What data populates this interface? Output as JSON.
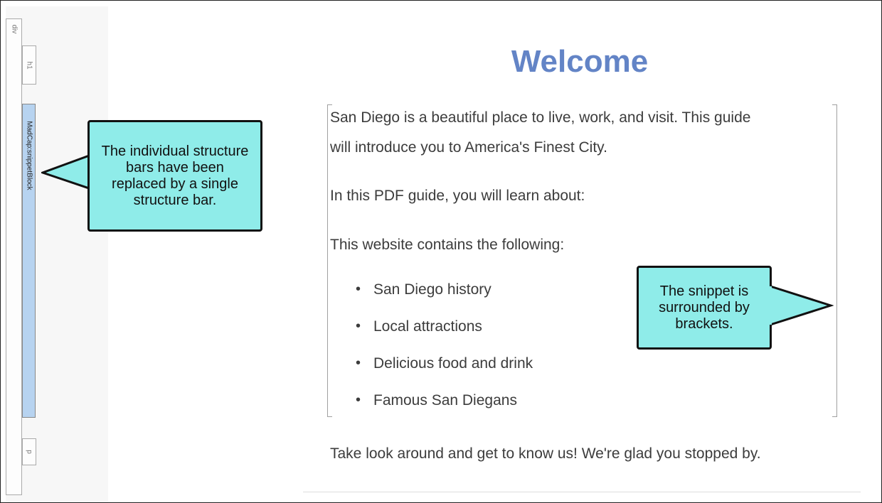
{
  "structure_bars": {
    "div": "div",
    "h1": "h1",
    "snippet": "MadCap:snippetBlock",
    "p": "p"
  },
  "content": {
    "title": "Welcome",
    "para1_line1": "San Diego is a beautiful place to live, work, and visit. This guide",
    "para1_line2": "will introduce you to America's Finest City.",
    "para2": "In this PDF guide, you will learn about:",
    "para3": "This website contains the following:",
    "bullets": [
      "San Diego history",
      "Local attractions",
      "Delicious food and drink",
      "Famous San Diegans"
    ],
    "para4": "Take look around and get to know us! We're glad you stopped by."
  },
  "callouts": {
    "left": "The individual structure bars have been replaced by a single structure bar.",
    "right": "The snippet is surrounded by brackets."
  },
  "colors": {
    "title": "#6384c6",
    "callout_fill": "#8fece9",
    "snippet_bar": "#b7d3f0"
  }
}
